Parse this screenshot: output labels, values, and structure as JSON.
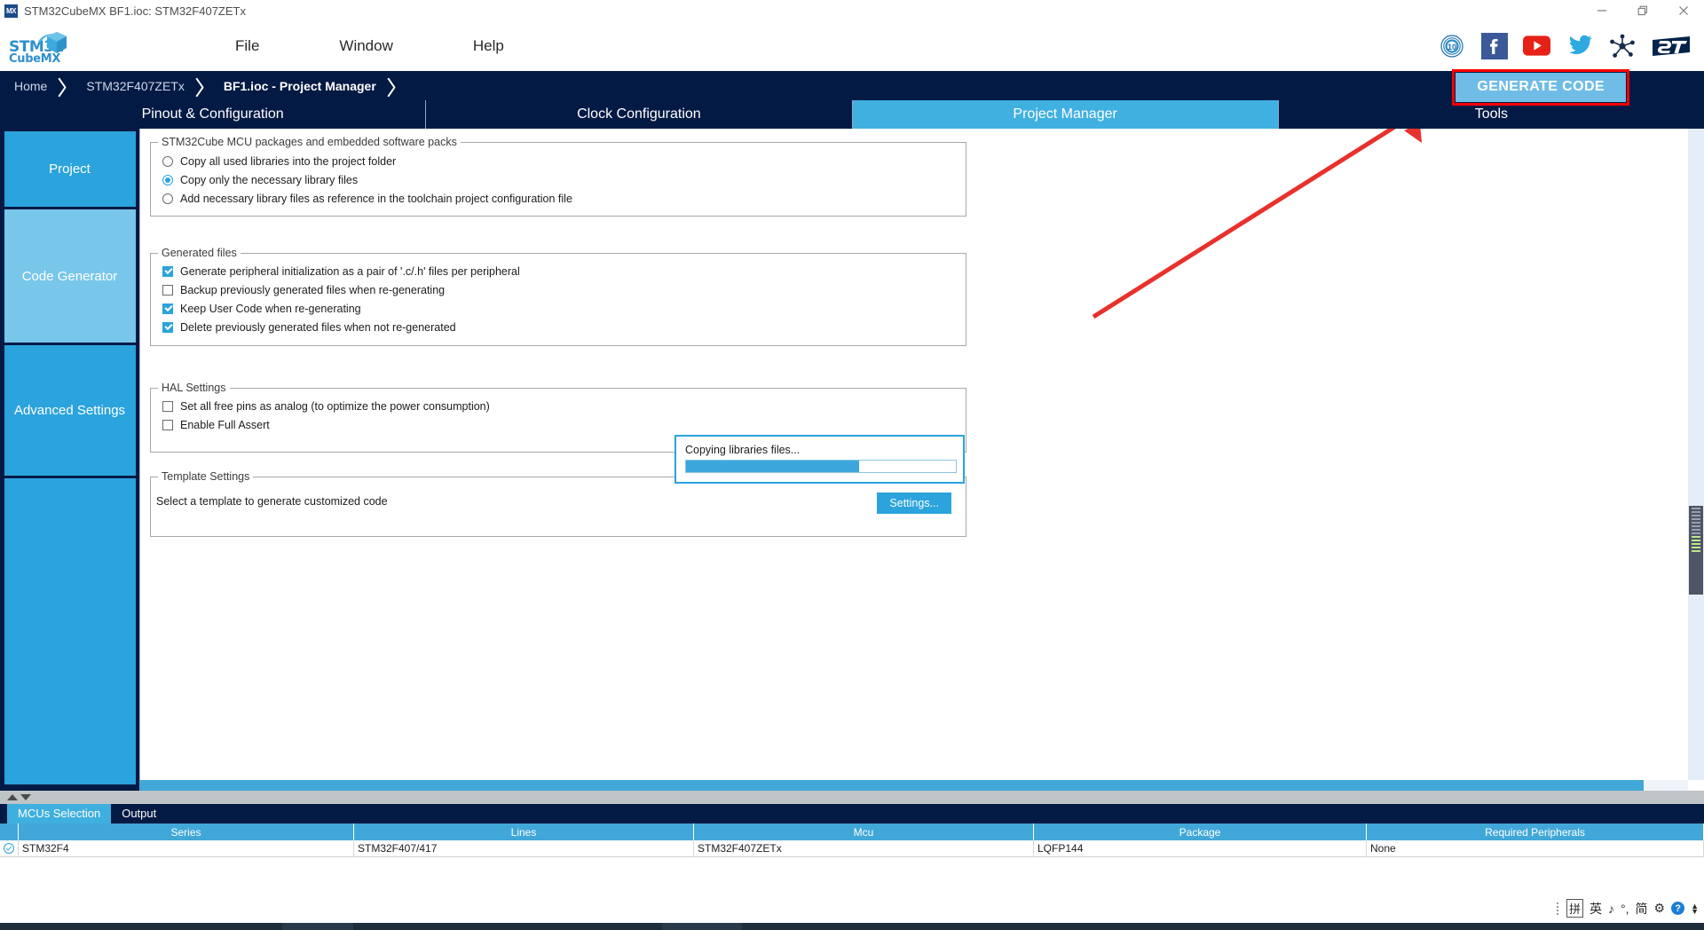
{
  "window": {
    "title": "STM32CubeMX BF1.ioc: STM32F407ZETx",
    "app_icon": "MX",
    "minimize_icon": "minimize-icon",
    "restore_icon": "restore-icon",
    "close_icon": "close-icon"
  },
  "logo": {
    "line1": "STM32",
    "line2": "CubeMX"
  },
  "menu": {
    "items": [
      {
        "label": "File"
      },
      {
        "label": "Window"
      },
      {
        "label": "Help"
      }
    ]
  },
  "social": {
    "items": [
      {
        "icon": "anniversary-10-years-icon",
        "label": ""
      },
      {
        "icon": "facebook-icon",
        "label": "f"
      },
      {
        "icon": "youtube-icon",
        "label": ""
      },
      {
        "icon": "twitter-icon",
        "label": ""
      },
      {
        "icon": "community-network-icon",
        "label": ""
      },
      {
        "icon": "st-logo-icon",
        "label": ""
      }
    ]
  },
  "breadcrumb": {
    "items": [
      {
        "label": "Home",
        "active": false
      },
      {
        "label": "STM32F407ZETx",
        "active": false
      },
      {
        "label": "BF1.ioc - Project Manager",
        "active": true
      }
    ],
    "generate_code_label": "GENERATE CODE",
    "highlight_color": "#fe0000",
    "button_color": "#6fbce6"
  },
  "main_tabs": [
    {
      "label": "Pinout & Configuration",
      "active": false
    },
    {
      "label": "Clock Configuration",
      "active": false
    },
    {
      "label": "Project Manager",
      "active": true
    },
    {
      "label": "Tools",
      "active": false
    }
  ],
  "left_rail": [
    {
      "label": "Project",
      "active": false
    },
    {
      "label": "Code Generator",
      "active": true
    },
    {
      "label": "Advanced Settings",
      "active": false
    },
    {
      "label": ""
    }
  ],
  "groups": {
    "packages": {
      "title": "STM32Cube MCU packages and embedded software packs",
      "options": [
        {
          "label": "Copy all used libraries into the project folder",
          "checked": false
        },
        {
          "label": "Copy only the necessary library files",
          "checked": true
        },
        {
          "label": "Add necessary library files as reference in the toolchain project configuration file",
          "checked": false
        }
      ]
    },
    "generated_files": {
      "title": "Generated files",
      "options": [
        {
          "label": "Generate peripheral initialization as a pair of '.c/.h' files per peripheral",
          "checked": true
        },
        {
          "label": "Backup previously generated files when re-generating",
          "checked": false
        },
        {
          "label": "Keep User Code when re-generating",
          "checked": true
        },
        {
          "label": "Delete previously generated files when not re-generated",
          "checked": true
        }
      ]
    },
    "hal_settings": {
      "title": "HAL Settings",
      "options": [
        {
          "label": "Set all free pins as analog (to optimize the power consumption)",
          "checked": false
        },
        {
          "label": "Enable Full Assert",
          "checked": false
        }
      ]
    },
    "template_settings": {
      "title": "Template Settings",
      "description": "Select a template to generate customized code",
      "settings_button": "Settings..."
    }
  },
  "progress_dialog": {
    "message": "Copying libraries files...",
    "percent": 64,
    "accent": "#3ba7dc"
  },
  "bottom_tabs": [
    {
      "label": "MCUs Selection",
      "active": true
    },
    {
      "label": "Output",
      "active": false
    }
  ],
  "mcu_table": {
    "columns": [
      "Series",
      "Lines",
      "Mcu",
      "Package",
      "Required Peripherals"
    ],
    "rows": [
      {
        "selected": true,
        "cells": [
          "STM32F4",
          "STM32F407/417",
          "STM32F407ZETx",
          "LQFP144",
          "None"
        ]
      }
    ]
  },
  "ime_tray": {
    "items": [
      "拼",
      "英",
      "♪",
      "°,",
      "简",
      "⚙"
    ],
    "help_label": "?"
  }
}
